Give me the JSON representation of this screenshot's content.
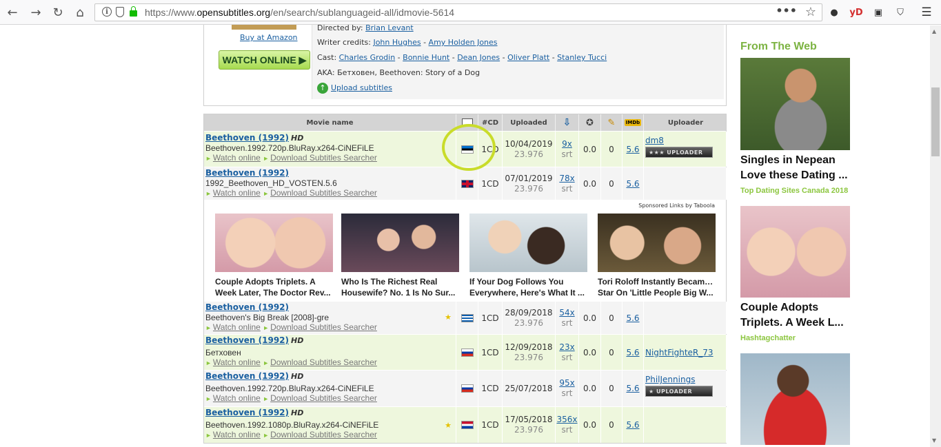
{
  "browser": {
    "url_prefix": "https://www.",
    "url_domain": "opensubtitles.org",
    "url_path": "/en/search/sublanguageid-all/idmovie-5614",
    "ext_yd": "yD"
  },
  "movie_info": {
    "amazon_link": "Buy at Amazon",
    "watch_online": "WATCH ONLINE ▶",
    "directed_label": "Directed by:",
    "director": "Brian Levant",
    "writer_label": "Writer credits:",
    "writers": [
      "John Hughes",
      "Amy Holden Jones"
    ],
    "cast_label": "Cast:",
    "cast": [
      "Charles Grodin",
      "Bonnie Hunt",
      "Dean Jones",
      "Oliver Platt",
      "Stanley Tucci"
    ],
    "aka": "AKA: Бетховен, Beethoven: Story of a Dog",
    "upload_link": "Upload subtitles"
  },
  "table": {
    "headers": {
      "name": "Movie name",
      "cd": "#CD",
      "uploaded": "Uploaded",
      "imdb": "IMDb",
      "uploader": "Uploader"
    },
    "rows": [
      {
        "title": "Beethoven (1992)",
        "hd": "HD",
        "file": "Beethoven.1992.720p.BluRay.x264-CiNEFiLE",
        "watch": "Watch online",
        "download": "Download Subtitles Searcher",
        "cd": "1CD",
        "date": "10/04/2019",
        "fps": "23.976",
        "dl": "9x",
        "fmt": "srt",
        "rate": "0.0",
        "comments": "0",
        "imdb": "5.6",
        "uploader": "dm8",
        "badge": "★★★ UPLOADER",
        "star": ""
      },
      {
        "title": "Beethoven (1992)",
        "hd": "",
        "file": "1992_Beethoven_HD_VOSTEN.5.6",
        "watch": "Watch online",
        "download": "Download Subtitles Searcher",
        "cd": "1CD",
        "date": "07/01/2019",
        "fps": "23.976",
        "dl": "78x",
        "fmt": "srt",
        "rate": "0.0",
        "comments": "0",
        "imdb": "5.6",
        "uploader": "",
        "badge": "",
        "star": ""
      },
      {
        "title": "Beethoven (1992)",
        "hd": "",
        "file": "Beethoven's Big Break [2008]-gre",
        "watch": "Watch online",
        "download": "Download Subtitles Searcher",
        "cd": "1CD",
        "date": "28/09/2018",
        "fps": "23.976",
        "dl": "54x",
        "fmt": "srt",
        "rate": "0.0",
        "comments": "0",
        "imdb": "5.6",
        "uploader": "",
        "badge": "",
        "star": "★"
      },
      {
        "title": "Beethoven (1992)",
        "hd": "HD",
        "file": "Бетховен",
        "watch": "Watch online",
        "download": "Download Subtitles Searcher",
        "cd": "1CD",
        "date": "12/09/2018",
        "fps": "23.976",
        "dl": "23x",
        "fmt": "srt",
        "rate": "0.0",
        "comments": "0",
        "imdb": "5.6",
        "uploader": "NightFighteR_73",
        "badge": "",
        "star": ""
      },
      {
        "title": "Beethoven (1992)",
        "hd": "HD",
        "file": "Beethoven.1992.720p.BluRay.x264-CiNEFiLE",
        "watch": "Watch online",
        "download": "Download Subtitles Searcher",
        "cd": "1CD",
        "date": "25/07/2018",
        "fps": "",
        "dl": "95x",
        "fmt": "srt",
        "rate": "0.0",
        "comments": "0",
        "imdb": "5.6",
        "uploader": "PhilJennings",
        "badge": "★ UPLOADER",
        "star": ""
      },
      {
        "title": "Beethoven (1992)",
        "hd": "HD",
        "file": "Beethoven.1992.1080p.BluRay.x264-CiNEFiLE",
        "watch": "Watch online",
        "download": "Download Subtitles Searcher",
        "cd": "1CD",
        "date": "17/05/2018",
        "fps": "23.976",
        "dl": "356x",
        "fmt": "srt",
        "rate": "0.0",
        "comments": "0",
        "imdb": "5.6",
        "uploader": "",
        "badge": "",
        "star": "★"
      }
    ]
  },
  "ads": {
    "sponsored": "Sponsored Links by Taboola",
    "items": [
      {
        "line1": "Couple Adopts Triplets. A",
        "line2": "Week Later, The Doctor Rev..."
      },
      {
        "line1": "Who Is The Richest Real",
        "line2": "Housewife? No. 1 Is No Sur..."
      },
      {
        "line1": "If Your Dog Follows You",
        "line2": "Everywhere, Here's What It ..."
      },
      {
        "line1": "Tori Roloff Instantly Became A",
        "line2": "Star On 'Little People Big W..."
      }
    ]
  },
  "sidebar": {
    "title": "From The Web",
    "items": [
      {
        "line1": "Singles in Nepean",
        "line2": "Love these Dating ...",
        "source": "Top Dating Sites Canada 2018"
      },
      {
        "line1": "Couple Adopts",
        "line2": "Triplets. A Week L...",
        "source": "Hashtagchatter"
      }
    ]
  }
}
